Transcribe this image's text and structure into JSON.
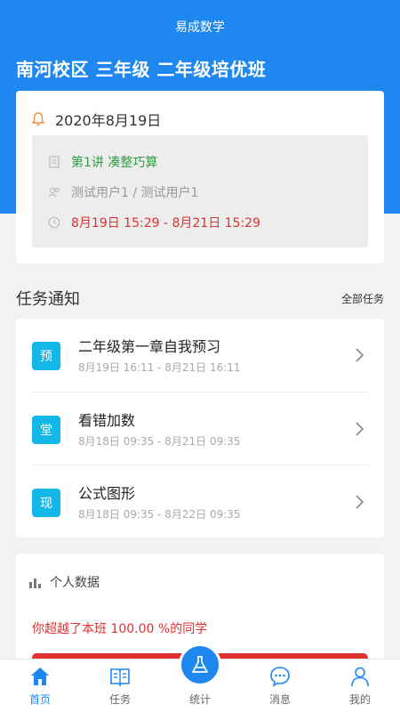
{
  "header": {
    "app_title": "易成数学",
    "class_title": "南河校区 三年级 二年级培优班"
  },
  "schedule": {
    "date": "2020年8月19日",
    "lesson_title": "第1讲 凑整巧算",
    "users": "测试用户1 / 测试用户1",
    "time_range": "8月19日 15:29 - 8月21日 15:29"
  },
  "tasks_section": {
    "title": "任务通知",
    "all_label": "全部任务",
    "items": [
      {
        "badge": "预",
        "name": "二年级第一章自我预习",
        "time": "8月19日 16:11 - 8月21日 16:11"
      },
      {
        "badge": "堂",
        "name": "看错加数",
        "time": "8月18日 09:35 - 8月21日 09:35"
      },
      {
        "badge": "现",
        "name": "公式图形",
        "time": "8月18日 09:35 - 8月22日 09:35"
      }
    ]
  },
  "stats": {
    "title": "个人数据",
    "summary": "你超越了本班 100.00 %的同学"
  },
  "tabbar": {
    "tabs": [
      {
        "label": "首页"
      },
      {
        "label": "任务"
      },
      {
        "label": "统计"
      },
      {
        "label": "消息"
      },
      {
        "label": "我的"
      }
    ]
  },
  "colors": {
    "primary": "#1e87f0",
    "badge": "#14b8e8",
    "success": "#2f9e44",
    "danger": "#e03131"
  }
}
